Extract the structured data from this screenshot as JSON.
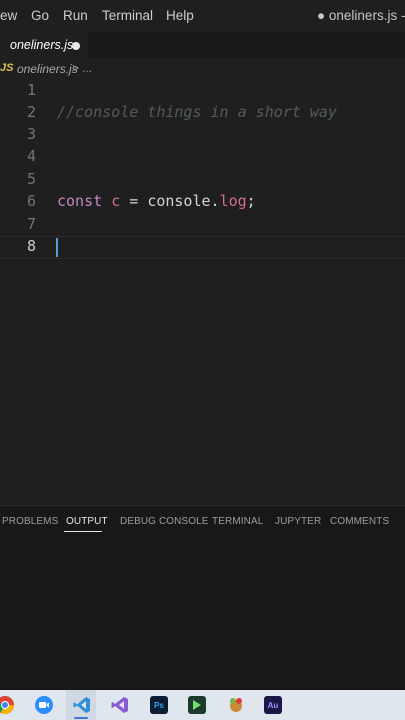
{
  "menubar": {
    "items": [
      "ew",
      "Go",
      "Run",
      "Terminal",
      "Help"
    ],
    "title": "● oneliners.js - o"
  },
  "tab": {
    "label": "oneliners.js"
  },
  "breadcrumb": {
    "lang": "JS",
    "file": "oneliners.js",
    "separator": ">",
    "more": "..."
  },
  "editor": {
    "lines": [
      {
        "num": "1"
      },
      {
        "num": "2",
        "comment": "//console things in a short way"
      },
      {
        "num": "3"
      },
      {
        "num": "4"
      },
      {
        "num": "5"
      },
      {
        "num": "6",
        "kw": "const",
        "var": "c",
        "op": "=",
        "obj": "console.",
        "method": "log",
        "end": ";"
      },
      {
        "num": "7"
      },
      {
        "num": "8"
      }
    ],
    "current_line": "8"
  },
  "panel": {
    "tabs": [
      "PROBLEMS",
      "OUTPUT",
      "DEBUG CONSOLE",
      "TERMINAL",
      "JUPYTER",
      "COMMENTS"
    ],
    "active_tab": "OUTPUT"
  },
  "taskbar": {
    "icons": [
      "chrome-icon",
      "zoom-icon",
      "vscode-icon",
      "visual-studio-icon",
      "photoshop-icon",
      "bluestacks-icon",
      "game-icon",
      "audition-icon"
    ],
    "ps_label": "Ps",
    "au_label": "Au"
  }
}
